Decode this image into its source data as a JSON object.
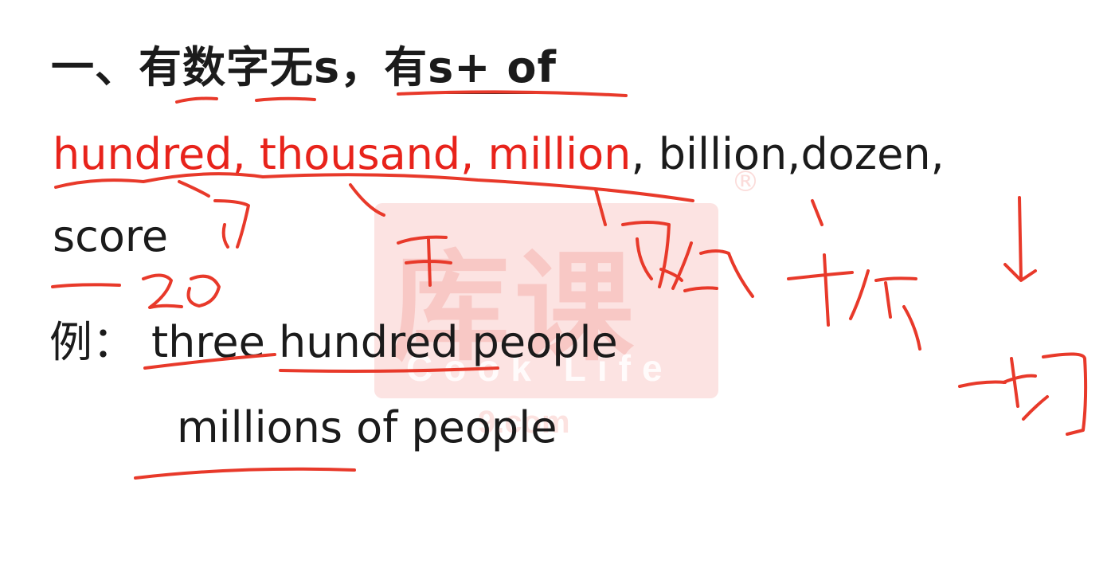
{
  "heading": {
    "part1": "一、有数字无s，有",
    "part2": "s+ of"
  },
  "line2": {
    "red": "hundred, thousand, million",
    "black": ", billion,dozen,"
  },
  "line3": {
    "text": "score"
  },
  "example": {
    "prefix": "例：",
    "sentence1": "three hundred people",
    "sentence2": "millions of people"
  },
  "watermark": {
    "brand_cn": "库课",
    "brand_en": "Cook Life",
    "url": "9.com",
    "registered": "®"
  },
  "colors": {
    "accent_red": "#e8231b",
    "ink_red": "#e8392a",
    "text": "#1b1b1b"
  }
}
